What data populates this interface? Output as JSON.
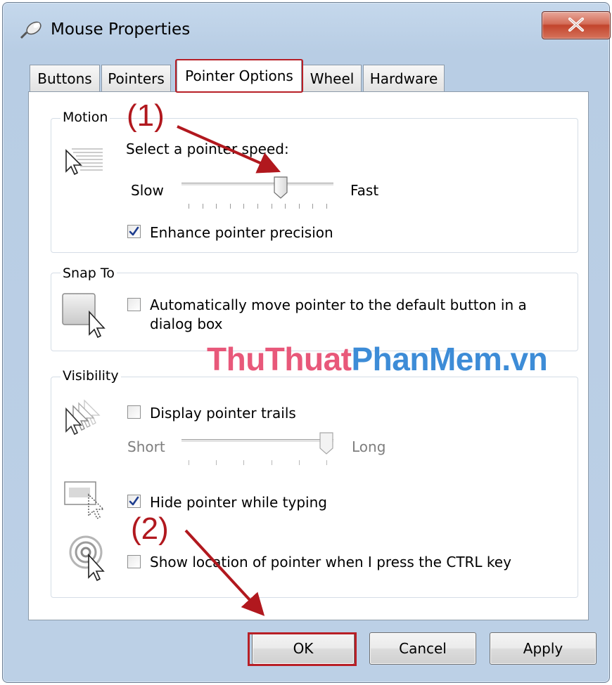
{
  "window": {
    "title": "Mouse Properties",
    "title_icon": "mouse-icon",
    "close_icon": "close-x-icon"
  },
  "tabs": [
    {
      "label": "Buttons",
      "active": false
    },
    {
      "label": "Pointers",
      "active": false
    },
    {
      "label": "Pointer Options",
      "active": true
    },
    {
      "label": "Wheel",
      "active": false
    },
    {
      "label": "Hardware",
      "active": false
    }
  ],
  "motion": {
    "group_label": "Motion",
    "speed_label": "Select a pointer speed:",
    "slow_label": "Slow",
    "fast_label": "Fast",
    "speed_position": 0.67,
    "tick_count": 11,
    "enhance_precision_label": "Enhance pointer precision",
    "enhance_precision_checked": true,
    "icon": "pointer-speed-icon"
  },
  "snap_to": {
    "group_label": "Snap To",
    "snap_label_line1": "Automatically move pointer to the default button in a",
    "snap_label_line2": "dialog box",
    "snap_checked": false,
    "icon": "snap-to-button-icon"
  },
  "visibility": {
    "group_label": "Visibility",
    "trails_label": "Display pointer trails",
    "trails_checked": false,
    "short_label": "Short",
    "long_label": "Long",
    "trail_length_position": 1.0,
    "trail_tick_count": 6,
    "hide_typing_label": "Hide pointer while typing",
    "hide_typing_checked": true,
    "show_location_label": "Show location of pointer when I press the CTRL key",
    "show_location_checked": false,
    "trails_icon": "pointer-trails-icon",
    "hide_icon": "hide-pointer-icon",
    "location_icon": "pointer-location-icon"
  },
  "buttons": {
    "ok": "OK",
    "cancel": "Cancel",
    "apply": "Apply"
  },
  "annotations": {
    "step1": "(1)",
    "step2": "(2)",
    "color": "#b1181e"
  },
  "watermark": {
    "part1": "ThuThuat",
    "part2": "PhanMem.vn",
    "color1": "#e8587a",
    "color2": "#3d8cd7"
  }
}
